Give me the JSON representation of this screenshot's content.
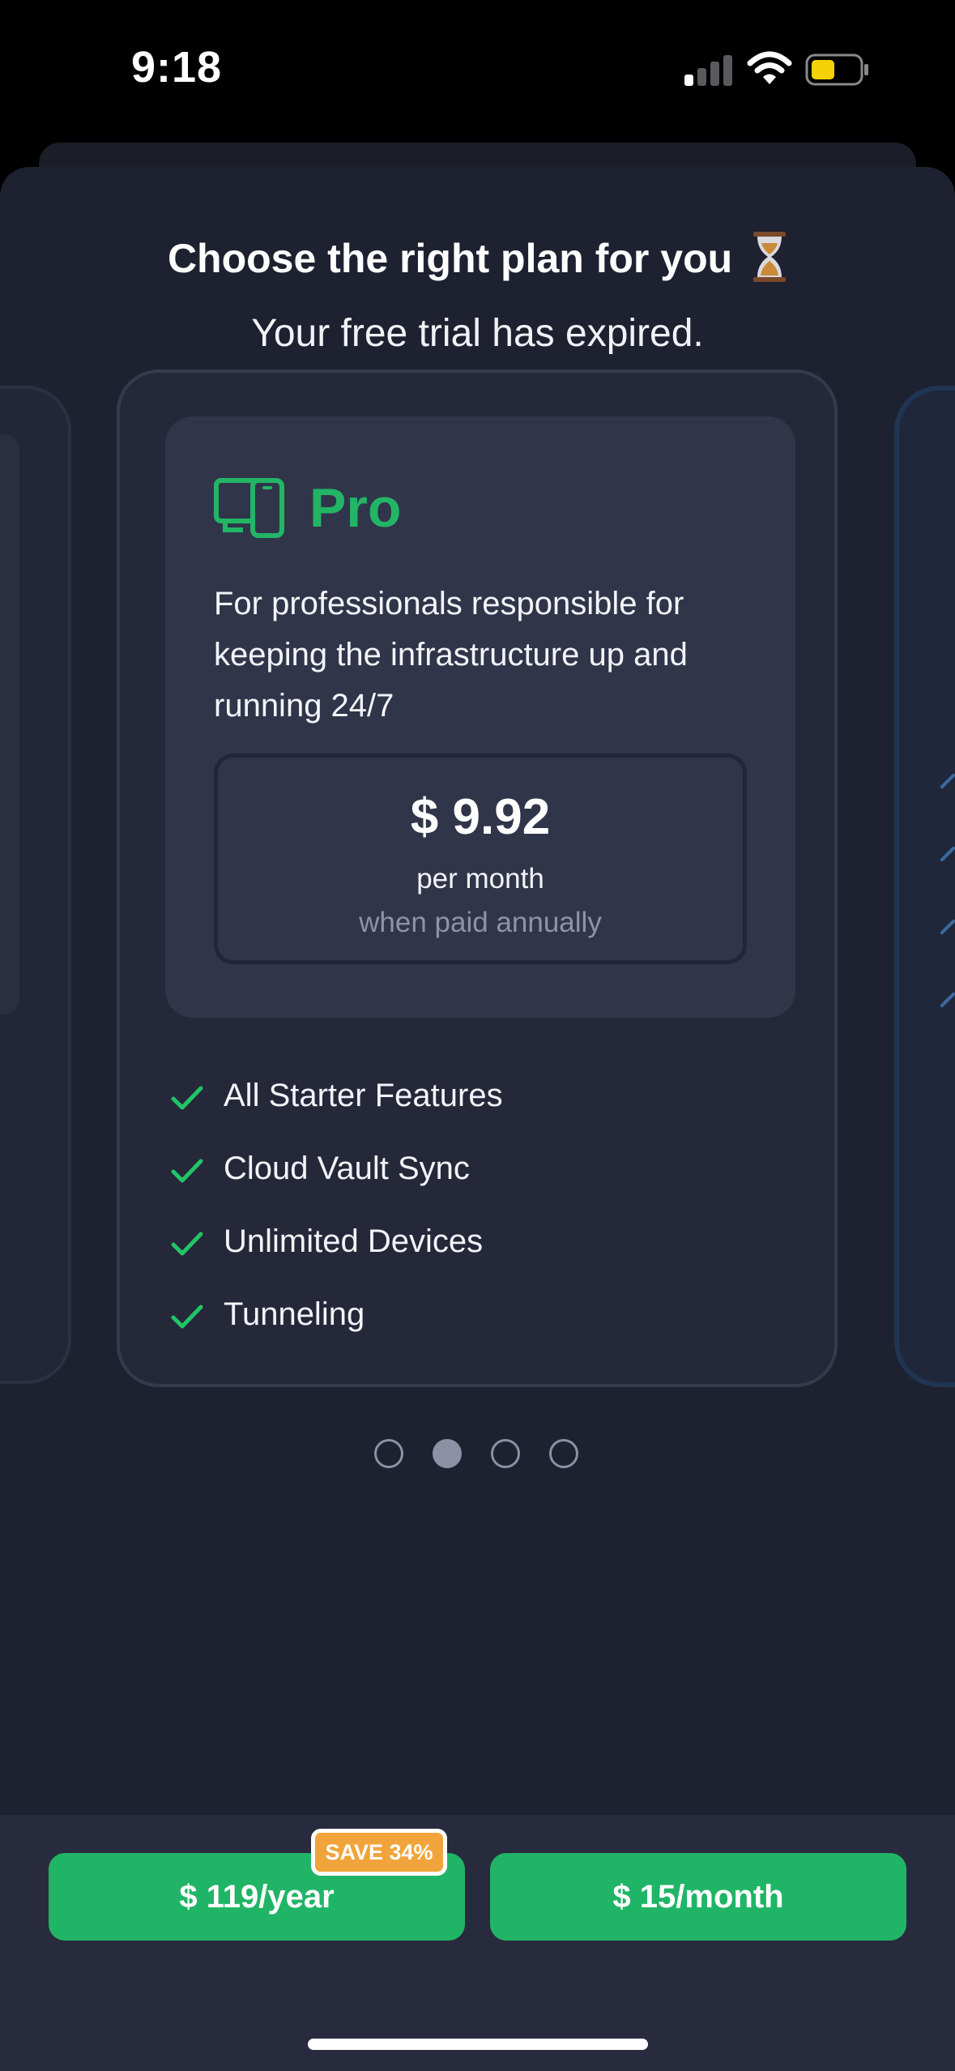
{
  "status_bar": {
    "time": "9:18"
  },
  "header": {
    "title": "Choose the right plan for you",
    "subtitle": "Your free trial has expired."
  },
  "plan": {
    "name": "Pro",
    "description": "For professionals responsible for keeping the infrastructure up and running 24/7",
    "price": "$ 9.92",
    "price_period": "per month",
    "price_note": "when paid annually",
    "features": [
      "All Starter Features",
      "Cloud Vault Sync",
      "Unlimited Devices",
      "Tunneling"
    ]
  },
  "pager": {
    "total": 4,
    "active_index": 1
  },
  "purchase": {
    "yearly_label": "$ 119/year",
    "monthly_label": "$ 15/month",
    "badge": "SAVE 34%"
  },
  "colors": {
    "accent_green": "#20b566",
    "badge_orange": "#f1a43b",
    "background": "#1e2130"
  }
}
